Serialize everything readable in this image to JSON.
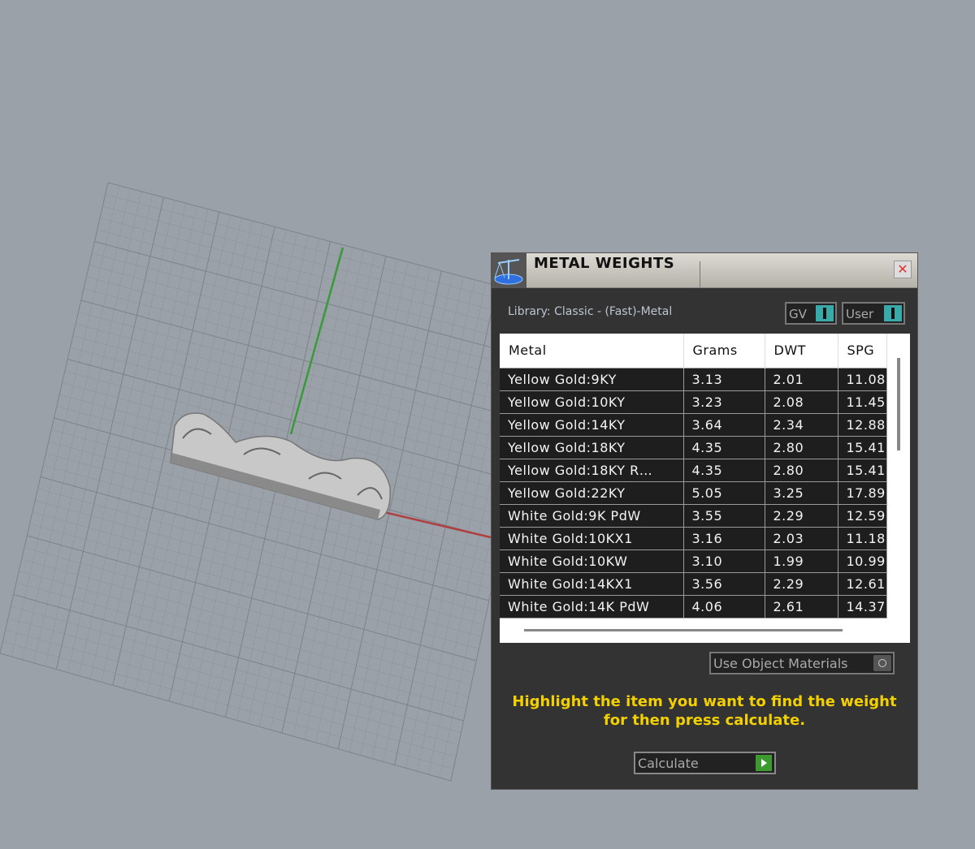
{
  "window": {
    "title": "METAL WEIGHTS",
    "close_label": "✕"
  },
  "library": "Library: Classic - (Fast)-Metal",
  "toggles": {
    "gv": "GV",
    "user": "User"
  },
  "table": {
    "headers": [
      "Metal",
      "Grams",
      "DWT",
      "SPG"
    ],
    "rows": [
      [
        "Yellow Gold:9KY",
        "3.13",
        "2.01",
        "11.08"
      ],
      [
        "Yellow Gold:10KY",
        "3.23",
        "2.08",
        "11.45"
      ],
      [
        "Yellow Gold:14KY",
        "3.64",
        "2.34",
        "12.88"
      ],
      [
        "Yellow Gold:18KY",
        "4.35",
        "2.80",
        "15.41"
      ],
      [
        "Yellow Gold:18KY R…",
        "4.35",
        "2.80",
        "15.41"
      ],
      [
        "Yellow Gold:22KY",
        "5.05",
        "3.25",
        "17.89"
      ],
      [
        "White Gold:9K PdW",
        "3.55",
        "2.29",
        "12.59"
      ],
      [
        "White Gold:10KX1",
        "3.16",
        "2.03",
        "11.18"
      ],
      [
        "White Gold:10KW",
        "3.10",
        "1.99",
        "10.99"
      ],
      [
        "White Gold:14KX1",
        "3.56",
        "2.29",
        "12.61"
      ],
      [
        "White Gold:14K PdW",
        "4.06",
        "2.61",
        "14.37"
      ]
    ]
  },
  "use_object_materials": "Use Object Materials",
  "hint": {
    "line1": "Highlight the item you want to find the weight",
    "line2": "for then press calculate."
  },
  "calculate_label": "Calculate"
}
